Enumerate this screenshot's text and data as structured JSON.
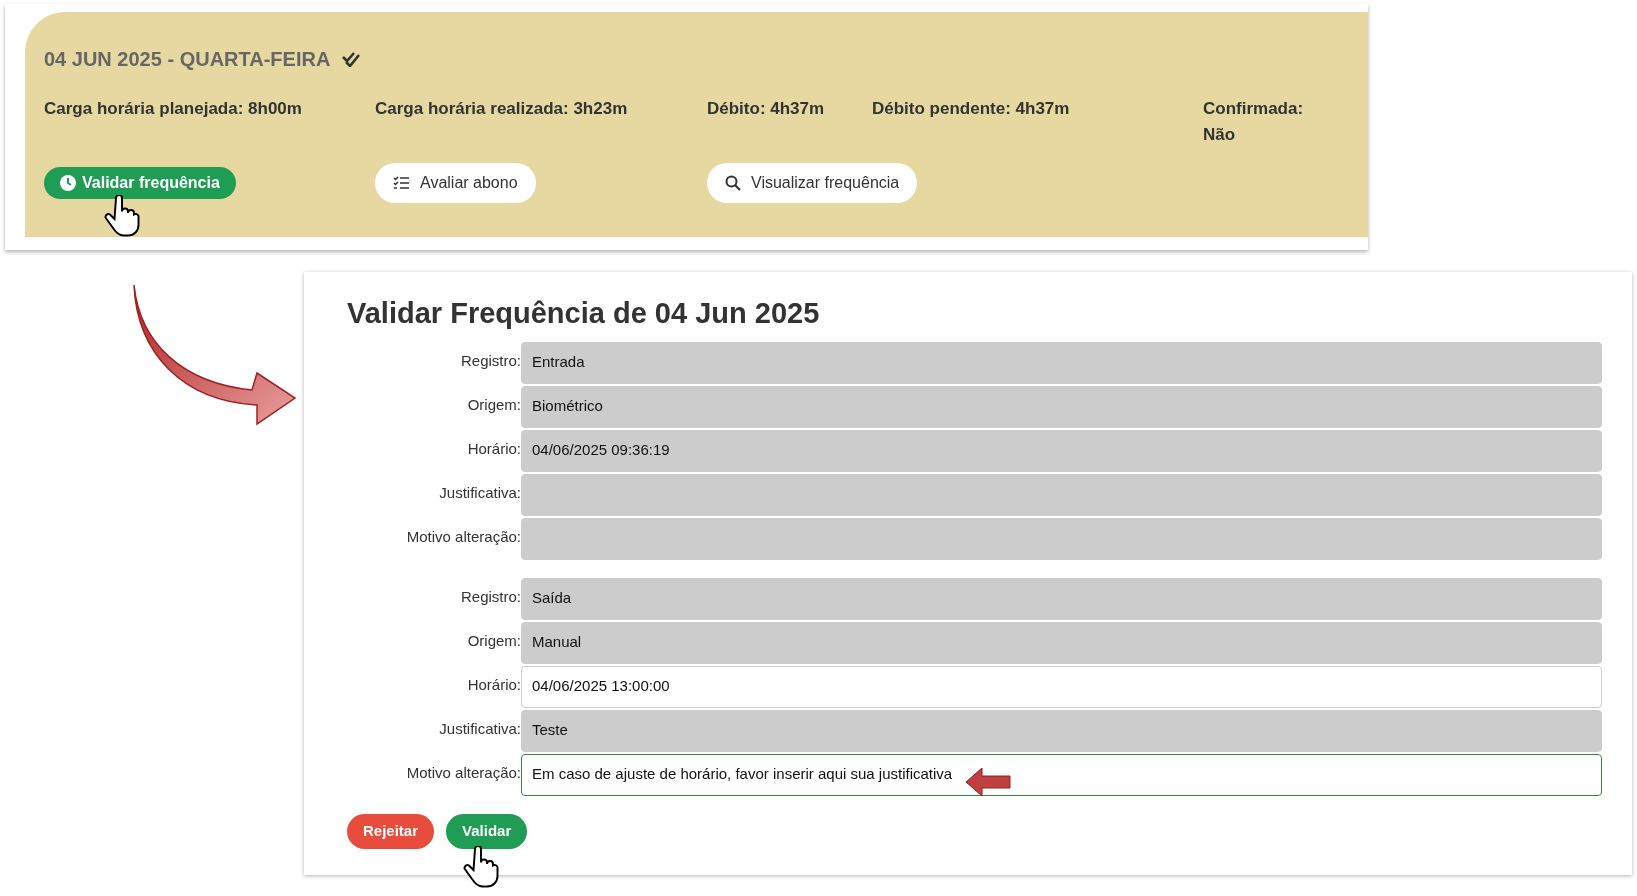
{
  "day_card": {
    "title": "04 JUN 2025 - QUARTA-FEIRA",
    "confirmed_check": true,
    "stats": [
      {
        "text": "Carga horária planejada: 8h00m"
      },
      {
        "text": "Carga horária realizada: 3h23m"
      },
      {
        "text": "Débito: 4h37m"
      },
      {
        "text": "Débito pendente: 4h37m"
      },
      {
        "text": "Confirmada: Não"
      }
    ],
    "buttons": [
      {
        "label": "Validar frequência",
        "kind": "primary"
      },
      {
        "label": "Avaliar abono",
        "kind": "list"
      },
      {
        "label": "Visualizar frequência",
        "kind": "search"
      }
    ]
  },
  "dialog": {
    "title": "Validar Frequência de 04 Jun 2025",
    "groups": [
      {
        "fields": [
          {
            "label": "Registro:",
            "value": "Entrada",
            "disabled": true,
            "focused": false
          },
          {
            "label": "Origem:",
            "value": "Biométrico",
            "disabled": true,
            "focused": false
          },
          {
            "label": "Horário:",
            "value": "04/06/2025 09:36:19",
            "disabled": true,
            "focused": false
          },
          {
            "label": "Justificativa:",
            "disabled": true,
            "focused": false
          },
          {
            "label": "Motivo alteração:",
            "disabled": true,
            "focused": false
          }
        ]
      },
      {
        "fields": [
          {
            "label": "Registro:",
            "value": "Saída",
            "disabled": true,
            "focused": false
          },
          {
            "label": "Origem:",
            "value": "Manual",
            "disabled": true,
            "focused": false
          },
          {
            "label": "Horário:",
            "value": "04/06/2025 13:00:00",
            "disabled": false,
            "focused": false
          },
          {
            "label": "Justificativa:",
            "value": "Teste",
            "disabled": true,
            "focused": false
          },
          {
            "label": "Motivo alteração:",
            "value": "Em caso de ajuste de horário, favor inserir aqui sua justificativa",
            "disabled": false,
            "focused": true
          }
        ]
      }
    ],
    "buttons": [
      {
        "label": "Rejeitar",
        "kind": "danger"
      },
      {
        "label": "Validar",
        "kind": "success"
      }
    ]
  }
}
